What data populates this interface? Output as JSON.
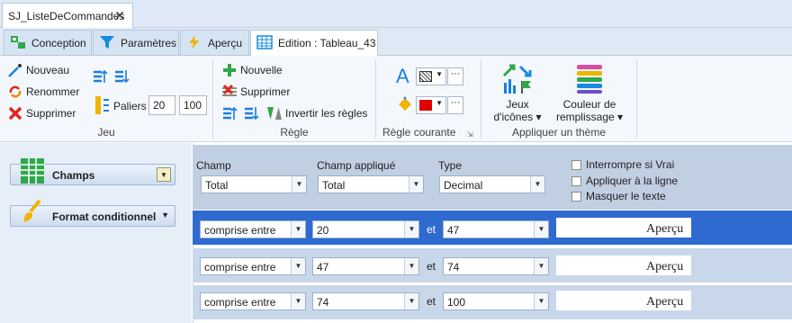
{
  "document_tab": {
    "label": "SJ_ListeDeCommandes",
    "close": "✕"
  },
  "sub_tabs": [
    {
      "label": "Conception",
      "icon": "conception-icon"
    },
    {
      "label": "Paramètres",
      "icon": "filter-icon"
    },
    {
      "label": "Aperçu",
      "icon": "lightning-icon"
    },
    {
      "label": "Edition : Tableau_43",
      "icon": "table-icon"
    }
  ],
  "ribbon": {
    "jeu": {
      "nouveau": "Nouveau",
      "renommer": "Renommer",
      "supprimer": "Supprimer",
      "paliers": "Paliers",
      "paliers_min": "20",
      "paliers_max": "100",
      "group_label": "Jeu"
    },
    "regle": {
      "nouvelle": "Nouvelle",
      "supprimer": "Supprimer",
      "invertir": "Invertir les règles",
      "group_label": "Règle"
    },
    "regle_courante": {
      "font_letter": "A",
      "group_label": "Règle courante",
      "fill_color": "#e00000"
    },
    "theme": {
      "jeux_icones": "Jeux d'icônes",
      "couleur_remplissage": "Couleur de remplissage",
      "group_label": "Appliquer un thème"
    }
  },
  "sidebar": {
    "champs": "Champs",
    "format": "Format conditionnel"
  },
  "header": {
    "champ_label": "Champ",
    "champ_value": "Total",
    "champ_applique_label": "Champ appliqué",
    "champ_applique_value": "Total",
    "type_label": "Type",
    "type_value": "Decimal",
    "interrompre": "Interrompre si Vrai",
    "appliquer_ligne": "Appliquer à la ligne",
    "masquer_texte": "Masquer le texte"
  },
  "rules": [
    {
      "condition": "comprise entre",
      "from": "20",
      "et": "et",
      "to": "47",
      "preview": "Aperçu"
    },
    {
      "condition": "comprise entre",
      "from": "47",
      "et": "et",
      "to": "74",
      "preview": "Aperçu"
    },
    {
      "condition": "comprise entre",
      "from": "74",
      "et": "et",
      "to": "100",
      "preview": "Aperçu"
    }
  ]
}
